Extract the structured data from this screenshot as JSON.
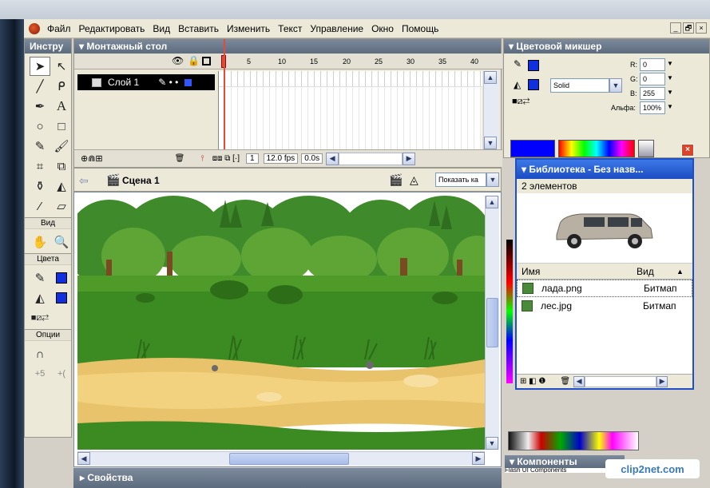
{
  "menu": {
    "items": [
      "Файл",
      "Редактировать",
      "Вид",
      "Вставить",
      "Изменить",
      "Текст",
      "Управление",
      "Окно",
      "Помощь"
    ]
  },
  "window_buttons": [
    "_",
    "🗗",
    "×"
  ],
  "tools_panel": {
    "title": "Инстру",
    "sections": {
      "view": "Вид",
      "colors": "Цвета",
      "options": "Опции"
    },
    "colors": {
      "stroke": "#1030e0",
      "fill": "#1030e0"
    }
  },
  "timeline": {
    "title": "Монтажный стол",
    "layer_name": "Слой 1",
    "ruler_ticks": [
      "1",
      "5",
      "10",
      "15",
      "20",
      "25",
      "30",
      "35",
      "40"
    ],
    "current_frame": "1",
    "fps": "12.0 fps",
    "time": "0.0s"
  },
  "scene": {
    "name": "Сцена 1",
    "zoom_select": "Показать ка"
  },
  "color_mixer": {
    "title": "Цветовой микшер",
    "fill_type": "Solid",
    "r_label": "R:",
    "r": "0",
    "g_label": "G:",
    "g": "0",
    "b_label": "B:",
    "b": "255",
    "alpha_label": "Альфа:",
    "alpha": "100%",
    "color": "#0000ff"
  },
  "library": {
    "title": "Библиотека - Без назв...",
    "count": "2 элементов",
    "col_name": "Имя",
    "col_kind": "Вид",
    "items": [
      {
        "name": "лада.png",
        "kind": "Битмап"
      },
      {
        "name": "лес.jpg",
        "kind": "Битмап"
      }
    ]
  },
  "components": {
    "title": "Компоненты",
    "sub": "Flash UI Components"
  },
  "watermark": "clip2net.com",
  "properties": {
    "title": "Свойства"
  }
}
